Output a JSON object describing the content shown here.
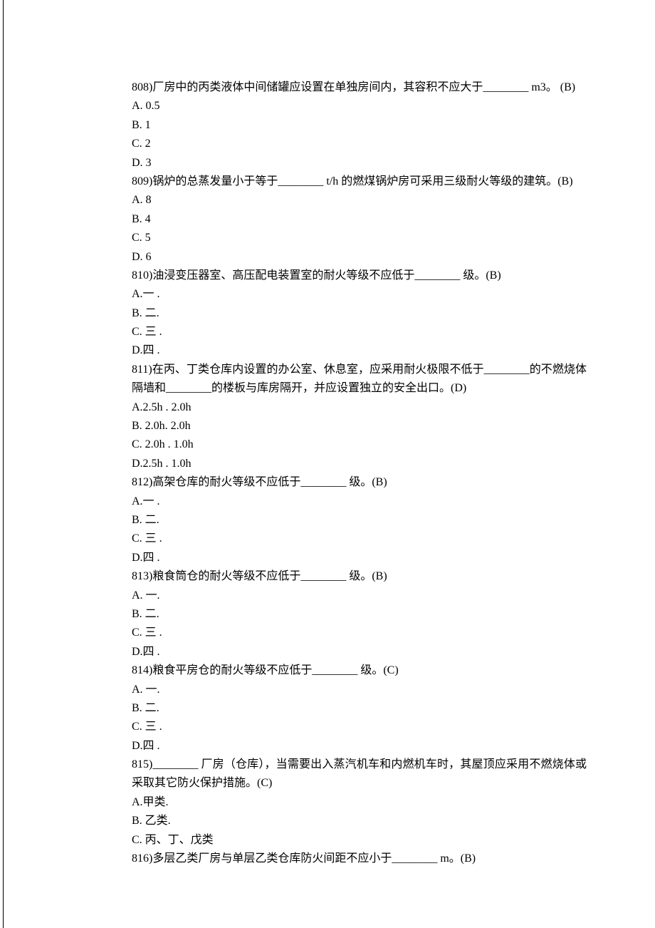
{
  "questions": [
    {
      "id": "q808",
      "stem": "808)厂房中的丙类液体中间储罐应设置在单独房间内，其容积不应大于________ m3。 (B)",
      "options": [
        {
          "id": "q808a",
          "text": "A. 0.5"
        },
        {
          "id": "q808b",
          "text": "B. 1"
        },
        {
          "id": "q808c",
          "text": "C. 2"
        },
        {
          "id": "q808d",
          "text": "D. 3"
        }
      ]
    },
    {
      "id": "q809",
      "stem": "809)锅炉的总蒸发量小于等于________ t/h 的燃煤锅炉房可采用三级耐火等级的建筑。(B)",
      "options": [
        {
          "id": "q809a",
          "text": "A. 8"
        },
        {
          "id": "q809b",
          "text": "B. 4"
        },
        {
          "id": "q809c",
          "text": "C. 5"
        },
        {
          "id": "q809d",
          "text": "D. 6"
        }
      ]
    },
    {
      "id": "q810",
      "stem": "810)油浸变压器室、高压配电装置室的耐火等级不应低于________ 级。(B)",
      "options": [
        {
          "id": "q810a",
          "text": "A.一 ."
        },
        {
          "id": "q810b",
          "text": "B. 二."
        },
        {
          "id": "q810c",
          "text": "C. 三 ."
        },
        {
          "id": "q810d",
          "text": "D.四 ."
        }
      ]
    },
    {
      "id": "q811",
      "stem": "811)在丙、丁类仓库内设置的办公室、休息室，应采用耐火极限不低于________的不燃烧体隔墙和________的楼板与库房隔开，并应设置独立的安全出口。(D)",
      "options": [
        {
          "id": "q811a",
          "text": "A.2.5h . 2.0h"
        },
        {
          "id": "q811b",
          "text": "B. 2.0h. 2.0h"
        },
        {
          "id": "q811c",
          "text": "C. 2.0h . 1.0h"
        },
        {
          "id": "q811d",
          "text": "D.2.5h . 1.0h"
        }
      ]
    },
    {
      "id": "q812",
      "stem": "812)高架仓库的耐火等级不应低于________ 级。(B)",
      "options": [
        {
          "id": "q812a",
          "text": "A.一 ."
        },
        {
          "id": "q812b",
          "text": "B. 二."
        },
        {
          "id": "q812c",
          "text": "C. 三 ."
        },
        {
          "id": "q812d",
          "text": "D.四 ."
        }
      ]
    },
    {
      "id": "q813",
      "stem": "813)粮食筒仓的耐火等级不应低于________ 级。(B)",
      "options": [
        {
          "id": "q813a",
          "text": "A. 一."
        },
        {
          "id": "q813b",
          "text": "B. 二."
        },
        {
          "id": "q813c",
          "text": "C. 三 ."
        },
        {
          "id": "q813d",
          "text": "D.四 ."
        }
      ]
    },
    {
      "id": "q814",
      "stem": "814)粮食平房仓的耐火等级不应低于________ 级。(C)",
      "options": [
        {
          "id": "q814a",
          "text": "A. 一."
        },
        {
          "id": "q814b",
          "text": "B. 二."
        },
        {
          "id": "q814c",
          "text": "C. 三 ."
        },
        {
          "id": "q814d",
          "text": "D.四 ."
        }
      ]
    },
    {
      "id": "q815",
      "stem": "815)________ 厂房（仓库），当需要出入蒸汽机车和内燃机车时，其屋顶应采用不燃烧体或采取其它防火保护措施。(C)",
      "options": [
        {
          "id": "q815a",
          "text": "A.甲类."
        },
        {
          "id": "q815b",
          "text": "B. 乙类."
        },
        {
          "id": "q815c",
          "text": "C. 丙、丁、戊类"
        }
      ]
    },
    {
      "id": "q816",
      "stem": "816)多层乙类厂房与单层乙类仓库防火间距不应小于________ m。(B)",
      "options": []
    }
  ]
}
